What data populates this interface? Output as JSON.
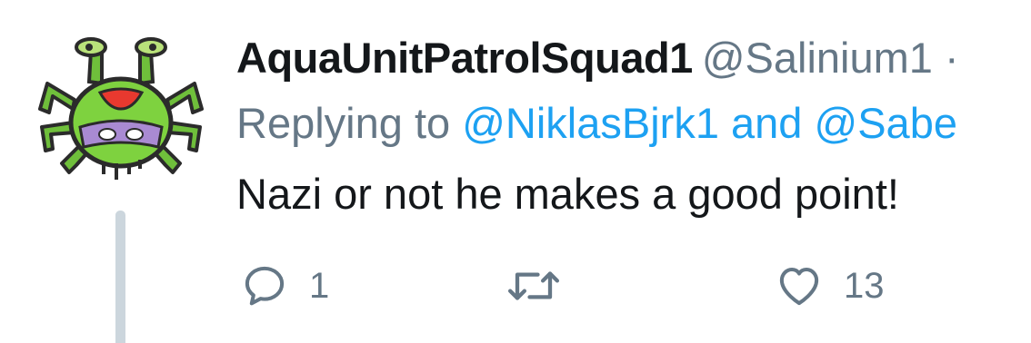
{
  "tweet": {
    "display_name": "AquaUnitPatrolSquad1",
    "handle": "@Salinium1 ·",
    "replying_prefix": "Replying to ",
    "replying_users": "@NiklasBjrk1 and @Sabe",
    "text": "Nazi or not he makes a good point!"
  },
  "actions": {
    "reply_count": "1",
    "retweet_count": "",
    "like_count": "13"
  },
  "icons": {
    "avatar": "green-crab-turtle-avatar",
    "reply": "reply-icon",
    "retweet": "retweet-icon",
    "like": "heart-icon"
  },
  "colors": {
    "name": "#14171a",
    "secondary": "#657786",
    "link": "#1da1f2",
    "thread_line": "#ccd6dd"
  }
}
